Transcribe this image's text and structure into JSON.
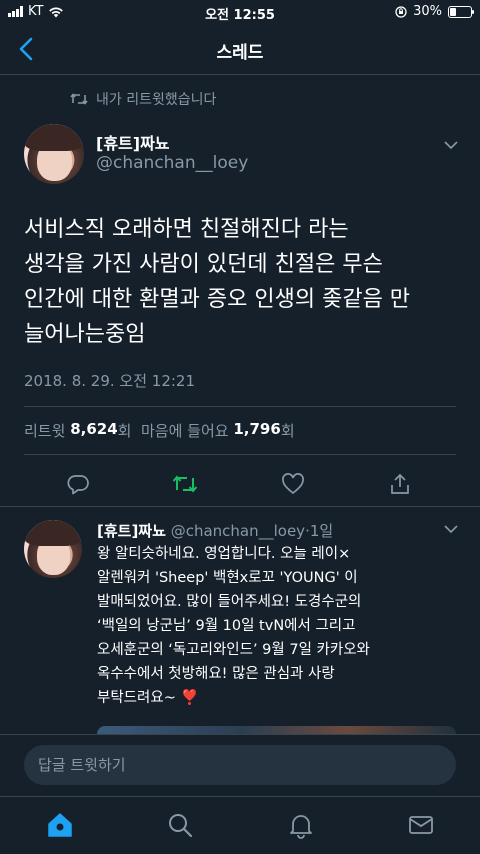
{
  "status_bar": {
    "carrier": "KT",
    "time": "오전 12:55",
    "battery": "30%",
    "battery_level": 0.3
  },
  "nav": {
    "title": "스레드"
  },
  "retweet_context": {
    "label": "내가 리트윗했습니다"
  },
  "main_tweet": {
    "name": "[휴트]짜뇨",
    "handle": "@chanchan__loey",
    "text_lines": [
      "서비스직 오래하면 친절해진다 라는",
      "생각을 가진 사람이 있던데 친절은 무슨",
      "인간에 대한 환멸과 증오 인생의 좆같음 만",
      "늘어나는중임"
    ],
    "timestamp": "2018. 8. 29. 오전 12:21",
    "stats": {
      "retweets_label": "리트윗",
      "retweets_count": "8,624",
      "count_suffix": "회",
      "likes_label": "마음에 들어요",
      "likes_count": "1,796"
    }
  },
  "reply_tweet": {
    "name": "[휴트]짜뇨",
    "handle": "@chanchan__loey",
    "age": "·1일",
    "text_lines": [
      "왕 알티슷하네요. 영업합니다. 오늘 레이×",
      "알렌워커 'Sheep' 백현x로꼬 'YOUNG' 이",
      "발매되었어요. 많이 들어주세요! 도경수군의",
      "‘백일의 낭군님’ 9월 10일 tvN에서  그리고",
      "오세훈군의 ‘독고리와인드’ 9월 7일 카카오와",
      "옥수수에서 첫방해요! 많은 관심과 사랑",
      "부탁드려요~ ❣️"
    ]
  },
  "compose": {
    "placeholder": "답글 트윗하기"
  },
  "colors": {
    "background": "#15202b",
    "secondary_text": "#8899a6",
    "accent": "#1da1f2",
    "retweet_green": "#17bf63",
    "divider": "#38444d"
  },
  "icons": [
    "back-chevron-icon",
    "retweet-icon",
    "reply-icon",
    "like-icon",
    "share-icon",
    "home-icon",
    "search-icon",
    "notifications-icon",
    "messages-icon"
  ]
}
